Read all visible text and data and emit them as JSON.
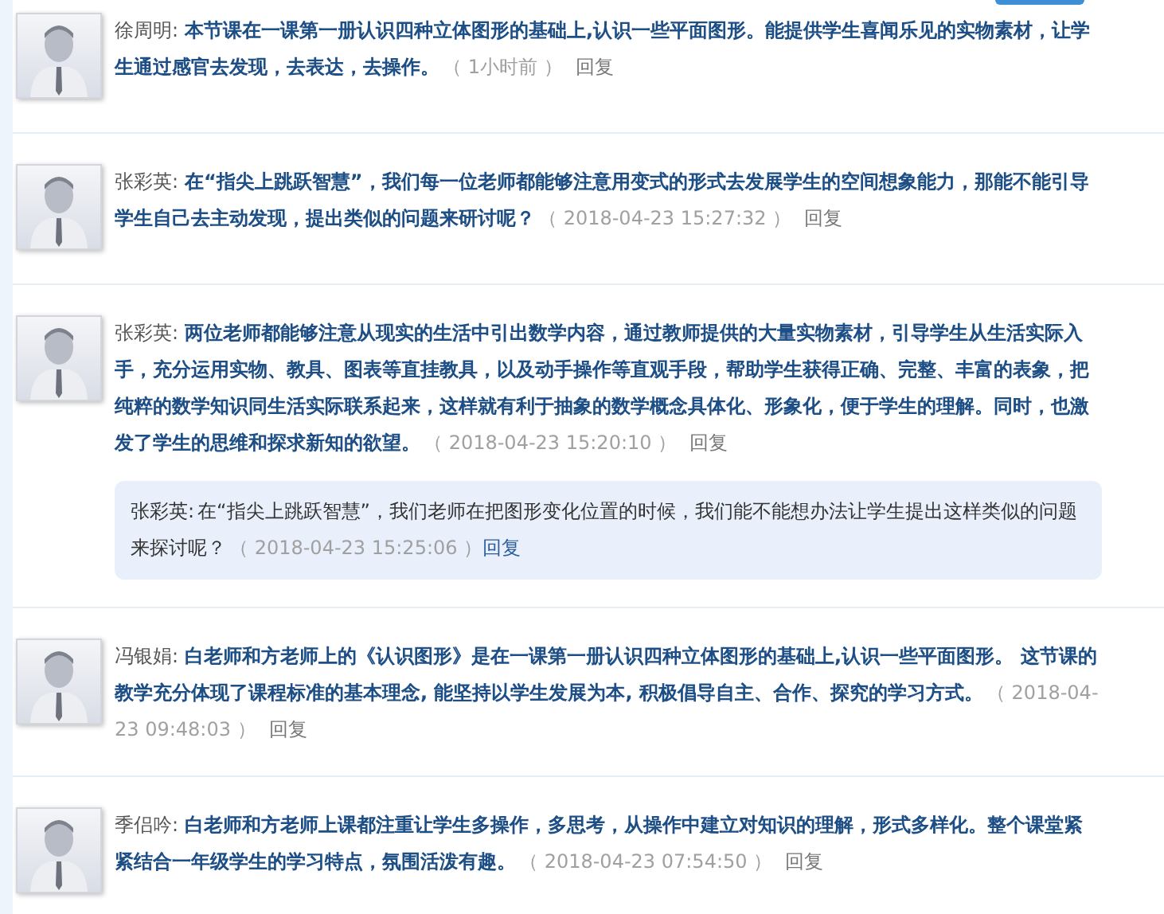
{
  "top_button": {
    "visible": true
  },
  "comments": [
    {
      "author": "徐周明:",
      "text": "本节课在一课第一册认识四种立体图形的基础上,认识一些平面图形。能提供学生喜闻乐见的实物素材，让学生通过感官去发现，去表达，去操作。",
      "time": "（ 1小时前 ）",
      "reply": "回复"
    },
    {
      "author": "张彩英:",
      "text": "在“指尖上跳跃智慧”，我们每一位老师都能够注意用变式的形式去发展学生的空间想象能力，那能不能引导学生自己去主动发现，提出类似的问题来研讨呢？",
      "time": "（ 2018-04-23 15:27:32 ）",
      "reply": "回复"
    },
    {
      "author": "张彩英:",
      "text": "两位老师都能够注意从现实的生活中引出数学内容，通过教师提供的大量实物素材，引导学生从生活实际入手，充分运用实物、教具、图表等直挂教具，以及动手操作等直观手段，帮助学生获得正确、完整、丰富的表象，把纯粹的数学知识同生活实际联系起来，这样就有利于抽象的数学概念具体化、形象化，便于学生的理解。同时，也激发了学生的思维和探求新知的欲望。",
      "time": "（ 2018-04-23 15:20:10 ）",
      "reply": "回复",
      "replies": [
        {
          "author": "张彩英:",
          "text": "在“指尖上跳跃智慧”，我们老师在把图形变化位置的时候，我们能不能想办法让学生提出这样类似的问题来探讨呢？",
          "time": "（ 2018-04-23 15:25:06 ）",
          "reply": "回复"
        }
      ]
    },
    {
      "author": "冯银娟:",
      "text": "白老师和方老师上的《认识图形》是在一课第一册认识四种立体图形的基础上,认识一些平面图形。 这节课的教学充分体现了课程标准的基本理念, 能坚持以学生发展为本, 积极倡导自主、合作、探究的学习方式。",
      "time": "（ 2018-04-23 09:48:03 ）",
      "reply": "回复"
    },
    {
      "author": "季侣吟:",
      "text": "白老师和方老师上课都注重让学生多操作，多思考，从操作中建立对知识的理解，形式多样化。整个课堂紧紧结合一年级学生的学习特点，氛围活泼有趣。",
      "time": "（ 2018-04-23 07:54:50 ）",
      "reply": "回复"
    }
  ]
}
